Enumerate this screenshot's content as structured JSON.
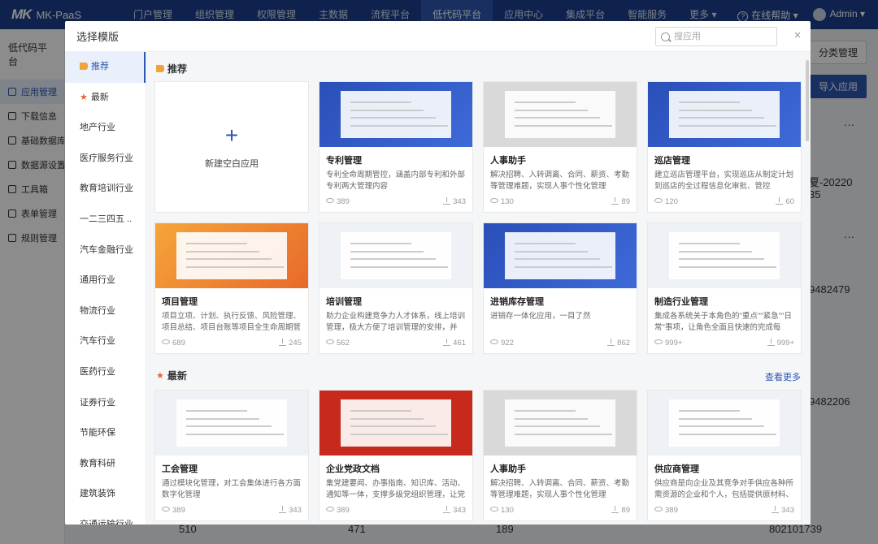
{
  "app": {
    "logo": "MK",
    "name": "MK-PaaS",
    "nav": [
      "门户管理",
      "组织管理",
      "权限管理",
      "主数据",
      "流程平台",
      "低代码平台",
      "应用中心",
      "集成平台",
      "智能服务",
      "更多 ▾"
    ],
    "active_nav": 5,
    "help": "在线帮助 ▾",
    "user": "Admin ▾"
  },
  "sidebar": {
    "title": "低代码平台",
    "items": [
      "应用管理",
      "下载信息",
      "基础数据库",
      "数据源设置",
      "工具箱",
      "表单管理",
      "规则管理"
    ]
  },
  "background": {
    "classify_button": "分类管理",
    "import_button": "导入应用",
    "more1": "···",
    "more2": "···",
    "text_a": "夏-20220",
    "text_b": "35",
    "text_c": "9482479",
    "text_d": "9482206",
    "bottom1": "510",
    "bottom2": "471",
    "bottom3": "189",
    "bottom4": "802101739"
  },
  "modal": {
    "title": "选择模版",
    "search_placeholder": "搜应用",
    "close": "×",
    "categories": [
      "推荐",
      "最新",
      "地产行业",
      "医疗服务行业",
      "教育培训行业",
      "一二三四五 ..",
      "汽车金融行业",
      "通用行业",
      "物流行业",
      "汽车行业",
      "医药行业",
      "证券行业",
      "节能环保",
      "教育科研",
      "建筑装饰",
      "交通运输行业"
    ],
    "recommend_title": "推荐",
    "latest_title": "最新",
    "view_more": "查看更多",
    "new_app": "新建空白应用",
    "recommend": [
      {
        "title": "专利管理",
        "desc": "专利全命周期管控，涵盖内部专利和外部专利两大管理内容",
        "views": "389",
        "downloads": "343",
        "thumb": "th-blue"
      },
      {
        "title": "人事助手",
        "desc": "解决招聘、入转调离、合同、薪资、考勤等管理难题，实现人事个性化管理",
        "views": "130",
        "downloads": "89",
        "thumb": "th-gray"
      },
      {
        "title": "巡店管理",
        "desc": "建立巡店管理平台，实现巡店从制定计划到巡店的全过程信息化审批、管控",
        "views": "120",
        "downloads": "60",
        "thumb": "th-blue"
      },
      {
        "title": "项目管理",
        "desc": "项目立项、计划、执行反馈、风险管理、项目总结、项目台账等项目全生命周期管理",
        "views": "689",
        "downloads": "245",
        "thumb": "th-orange"
      },
      {
        "title": "培训管理",
        "desc": "助力企业构建竞争力人才体系，线上培训管理，极大方便了培训管理的安排，并且...",
        "views": "562",
        "downloads": "461",
        "thumb": "th-light"
      },
      {
        "title": "进销库存管理",
        "desc": "进销存一体化应用，一目了然",
        "views": "922",
        "downloads": "862",
        "thumb": "th-blue"
      },
      {
        "title": "制造行业管理",
        "desc": "集成各系统关于本角色的\"重点\"\"紧急\"\"日常\"事项，让角色全面且快速的完成每天...",
        "views": "999+",
        "downloads": "999+",
        "thumb": "th-light"
      }
    ],
    "latest": [
      {
        "title": "工会管理",
        "desc": "通过模块化管理，对工会集体进行各方面数字化管理",
        "views": "389",
        "downloads": "343",
        "thumb": "th-light"
      },
      {
        "title": "企业党政文档",
        "desc": "集党建要闻、办事指南、知识库、活动、通知等一体，支撑多级党组织管理，让党务...",
        "views": "389",
        "downloads": "343",
        "thumb": "th-red"
      },
      {
        "title": "人事助手",
        "desc": "解决招聘、入转调离、合同、薪资、考勤等管理难题，实现人事个性化管理",
        "views": "130",
        "downloads": "89",
        "thumb": "th-gray"
      },
      {
        "title": "供应商管理",
        "desc": "供应商是向企业及其竞争对手供应各种所需资源的企业和个人，包括提供原材料、设...",
        "views": "389",
        "downloads": "343",
        "thumb": "th-light"
      }
    ]
  },
  "colors": {
    "primary": "#2d56b0",
    "topbar": "#1b3f8c",
    "accent": "#f0a23b"
  }
}
